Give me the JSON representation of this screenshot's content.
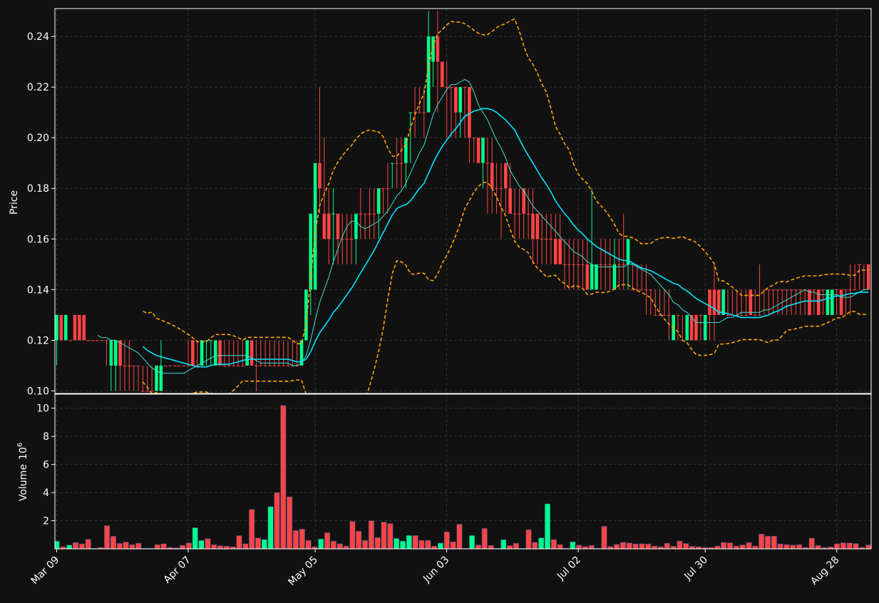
{
  "chart_data": {
    "type": "candlestick",
    "x": [
      "2024-03-09",
      "2024-03-10",
      "2024-03-11",
      "2024-03-12",
      "2024-03-13",
      "2024-03-14",
      "2024-03-15",
      "2024-03-16",
      "2024-03-17",
      "2024-03-18",
      "2024-03-19",
      "2024-03-20",
      "2024-03-21",
      "2024-03-22",
      "2024-03-23",
      "2024-03-24",
      "2024-03-25",
      "2024-03-26",
      "2024-03-27",
      "2024-03-28",
      "2024-03-29",
      "2024-03-30",
      "2024-03-31",
      "2024-04-01",
      "2024-04-02",
      "2024-04-03",
      "2024-04-04",
      "2024-04-05",
      "2024-04-06",
      "2024-04-07",
      "2024-04-08",
      "2024-04-09",
      "2024-04-10",
      "2024-04-11",
      "2024-04-12",
      "2024-04-13",
      "2024-04-14",
      "2024-04-15",
      "2024-04-16",
      "2024-04-17",
      "2024-04-18",
      "2024-04-19",
      "2024-04-20",
      "2024-04-21",
      "2024-04-22",
      "2024-04-23",
      "2024-04-24",
      "2024-04-25",
      "2024-04-26",
      "2024-04-27",
      "2024-04-28",
      "2024-04-29",
      "2024-04-30",
      "2024-05-01",
      "2024-05-02",
      "2024-05-03",
      "2024-05-04",
      "2024-05-05",
      "2024-05-06",
      "2024-05-07",
      "2024-05-08",
      "2024-05-09",
      "2024-05-10",
      "2024-05-11",
      "2024-05-12",
      "2024-05-13",
      "2024-05-14",
      "2024-05-15",
      "2024-05-16",
      "2024-05-17",
      "2024-05-18",
      "2024-05-19",
      "2024-05-20",
      "2024-05-21",
      "2024-05-22",
      "2024-05-23",
      "2024-05-24",
      "2024-05-25",
      "2024-05-26",
      "2024-05-27",
      "2024-05-28",
      "2024-05-29",
      "2024-05-30",
      "2024-05-31",
      "2024-06-01",
      "2024-06-02",
      "2024-06-03",
      "2024-06-04",
      "2024-06-05",
      "2024-06-06",
      "2024-06-07",
      "2024-06-08",
      "2024-06-09",
      "2024-06-10",
      "2024-06-11",
      "2024-06-12",
      "2024-06-13",
      "2024-06-14",
      "2024-06-15",
      "2024-06-16",
      "2024-06-17",
      "2024-06-18",
      "2024-06-19",
      "2024-06-20",
      "2024-06-21",
      "2024-06-22",
      "2024-06-23",
      "2024-06-24",
      "2024-06-25",
      "2024-06-26",
      "2024-06-27",
      "2024-06-28",
      "2024-06-29",
      "2024-06-30",
      "2024-07-01",
      "2024-07-02",
      "2024-07-03",
      "2024-07-04",
      "2024-07-05",
      "2024-07-06",
      "2024-07-07",
      "2024-07-08",
      "2024-07-09",
      "2024-07-10",
      "2024-07-11",
      "2024-07-12",
      "2024-07-13",
      "2024-07-14",
      "2024-07-15",
      "2024-07-16",
      "2024-07-17",
      "2024-07-18",
      "2024-07-19",
      "2024-07-20",
      "2024-07-21",
      "2024-07-22",
      "2024-07-23",
      "2024-07-24",
      "2024-07-25",
      "2024-07-26",
      "2024-07-27",
      "2024-07-28",
      "2024-07-29",
      "2024-07-30",
      "2024-07-31",
      "2024-08-01",
      "2024-08-02",
      "2024-08-03",
      "2024-08-04",
      "2024-08-05",
      "2024-08-06",
      "2024-08-07",
      "2024-08-08",
      "2024-08-09",
      "2024-08-10",
      "2024-08-11",
      "2024-08-12",
      "2024-08-13",
      "2024-08-14",
      "2024-08-15",
      "2024-08-16",
      "2024-08-17",
      "2024-08-18",
      "2024-08-19",
      "2024-08-20",
      "2024-08-21",
      "2024-08-22",
      "2024-08-23",
      "2024-08-24",
      "2024-08-25",
      "2024-08-26",
      "2024-08-27",
      "2024-08-28",
      "2024-08-29",
      "2024-08-30",
      "2024-08-31",
      "2024-09-01",
      "2024-09-02",
      "2024-09-03",
      "2024-09-04"
    ],
    "open": [
      0.12,
      0.13,
      0.12,
      0.12,
      0.13,
      0.13,
      0.13,
      0.12,
      0.12,
      0.12,
      0.12,
      0.12,
      0.11,
      0.11,
      0.12,
      0.11,
      0.11,
      0.11,
      0.11,
      0.1,
      0.1,
      0.1,
      0.1,
      0.1,
      0.11,
      0.11,
      0.11,
      0.11,
      0.11,
      0.11,
      0.12,
      0.11,
      0.11,
      0.12,
      0.12,
      0.11,
      0.12,
      0.11,
      0.11,
      0.11,
      0.11,
      0.11,
      0.11,
      0.12,
      0.11,
      0.11,
      0.11,
      0.11,
      0.11,
      0.11,
      0.11,
      0.11,
      0.11,
      0.11,
      0.11,
      0.12,
      0.14,
      0.14,
      0.19,
      0.17,
      0.17,
      0.17,
      0.17,
      0.16,
      0.16,
      0.16,
      0.16,
      0.17,
      0.17,
      0.17,
      0.17,
      0.17,
      0.18,
      0.18,
      0.19,
      0.19,
      0.19,
      0.19,
      0.21,
      0.21,
      0.21,
      0.21,
      0.21,
      0.23,
      0.24,
      0.23,
      0.22,
      0.22,
      0.22,
      0.21,
      0.22,
      0.22,
      0.2,
      0.2,
      0.19,
      0.19,
      0.19,
      0.18,
      0.18,
      0.19,
      0.18,
      0.17,
      0.17,
      0.18,
      0.17,
      0.17,
      0.17,
      0.16,
      0.16,
      0.16,
      0.16,
      0.16,
      0.15,
      0.15,
      0.15,
      0.15,
      0.15,
      0.15,
      0.14,
      0.14,
      0.15,
      0.15,
      0.15,
      0.14,
      0.15,
      0.15,
      0.15,
      0.14,
      0.14,
      0.14,
      0.14,
      0.14,
      0.13,
      0.13,
      0.13,
      0.13,
      0.12,
      0.13,
      0.12,
      0.12,
      0.13,
      0.13,
      0.13,
      0.12,
      0.14,
      0.14,
      0.14,
      0.13,
      0.13,
      0.13,
      0.13,
      0.13,
      0.13,
      0.14,
      0.13,
      0.13,
      0.14,
      0.14,
      0.14,
      0.14,
      0.14,
      0.14,
      0.14,
      0.14,
      0.14,
      0.14,
      0.14,
      0.14,
      0.14,
      0.14,
      0.13,
      0.13,
      0.14,
      0.14,
      0.14,
      0.14,
      0.14,
      0.15,
      0.14,
      0.15,
      0.15,
      0.15,
      0.15,
      0.15,
      0.15,
      0.15,
      0.15,
      0.15,
      0.15,
      0.15
    ],
    "high": [
      0.13,
      0.13,
      0.13,
      0.12,
      0.13,
      0.13,
      0.13,
      0.12,
      0.12,
      0.12,
      0.12,
      0.12,
      0.12,
      0.12,
      0.12,
      0.12,
      0.12,
      0.11,
      0.11,
      0.11,
      0.11,
      0.11,
      0.11,
      0.12,
      0.11,
      0.11,
      0.11,
      0.11,
      0.11,
      0.12,
      0.12,
      0.12,
      0.12,
      0.12,
      0.12,
      0.12,
      0.12,
      0.12,
      0.12,
      0.12,
      0.12,
      0.12,
      0.12,
      0.12,
      0.12,
      0.12,
      0.12,
      0.12,
      0.12,
      0.12,
      0.12,
      0.12,
      0.12,
      0.12,
      0.12,
      0.14,
      0.15,
      0.18,
      0.22,
      0.2,
      0.18,
      0.18,
      0.17,
      0.17,
      0.17,
      0.17,
      0.17,
      0.18,
      0.17,
      0.18,
      0.18,
      0.18,
      0.18,
      0.19,
      0.19,
      0.2,
      0.2,
      0.2,
      0.21,
      0.22,
      0.22,
      0.22,
      0.25,
      0.24,
      0.25,
      0.23,
      0.23,
      0.22,
      0.22,
      0.22,
      0.22,
      0.22,
      0.2,
      0.2,
      0.2,
      0.2,
      0.2,
      0.19,
      0.19,
      0.19,
      0.19,
      0.18,
      0.18,
      0.18,
      0.18,
      0.18,
      0.17,
      0.17,
      0.17,
      0.17,
      0.17,
      0.17,
      0.16,
      0.16,
      0.16,
      0.16,
      0.16,
      0.16,
      0.18,
      0.15,
      0.16,
      0.16,
      0.16,
      0.16,
      0.16,
      0.17,
      0.16,
      0.15,
      0.15,
      0.15,
      0.15,
      0.14,
      0.14,
      0.14,
      0.14,
      0.14,
      0.13,
      0.13,
      0.13,
      0.13,
      0.13,
      0.13,
      0.13,
      0.13,
      0.13,
      0.15,
      0.14,
      0.14,
      0.14,
      0.14,
      0.14,
      0.14,
      0.14,
      0.14,
      0.14,
      0.15,
      0.14,
      0.14,
      0.14,
      0.14,
      0.14,
      0.14,
      0.14,
      0.14,
      0.14,
      0.14,
      0.14,
      0.14,
      0.14,
      0.14,
      0.14,
      0.14,
      0.14,
      0.14,
      0.14,
      0.15,
      0.15,
      0.15,
      0.15,
      0.15,
      0.15,
      0.15,
      0.15,
      0.15,
      0.15,
      0.15,
      0.15,
      0.15,
      0.15,
      0.15,
      0.15,
      0.15
    ],
    "low": [
      0.11,
      0.12,
      0.12,
      0.12,
      0.12,
      0.12,
      0.12,
      0.12,
      0.12,
      0.12,
      0.12,
      0.11,
      0.1,
      0.1,
      0.1,
      0.1,
      0.1,
      0.1,
      0.1,
      0.1,
      0.1,
      0.1,
      0.1,
      0.1,
      0.11,
      0.11,
      0.11,
      0.11,
      0.11,
      0.11,
      0.11,
      0.11,
      0.11,
      0.11,
      0.11,
      0.11,
      0.11,
      0.11,
      0.11,
      0.11,
      0.11,
      0.11,
      0.11,
      0.11,
      0.1,
      0.11,
      0.11,
      0.11,
      0.11,
      0.11,
      0.11,
      0.11,
      0.11,
      0.11,
      0.11,
      0.12,
      0.13,
      0.14,
      0.17,
      0.17,
      0.15,
      0.15,
      0.15,
      0.15,
      0.15,
      0.15,
      0.15,
      0.16,
      0.16,
      0.16,
      0.16,
      0.16,
      0.17,
      0.17,
      0.18,
      0.18,
      0.18,
      0.18,
      0.19,
      0.2,
      0.21,
      0.2,
      0.21,
      0.22,
      0.21,
      0.22,
      0.2,
      0.2,
      0.2,
      0.2,
      0.2,
      0.19,
      0.19,
      0.19,
      0.18,
      0.17,
      0.17,
      0.17,
      0.16,
      0.17,
      0.17,
      0.16,
      0.16,
      0.16,
      0.16,
      0.15,
      0.15,
      0.15,
      0.15,
      0.15,
      0.15,
      0.15,
      0.14,
      0.14,
      0.14,
      0.14,
      0.14,
      0.14,
      0.14,
      0.14,
      0.14,
      0.14,
      0.14,
      0.14,
      0.14,
      0.14,
      0.14,
      0.14,
      0.14,
      0.14,
      0.13,
      0.13,
      0.13,
      0.13,
      0.13,
      0.12,
      0.12,
      0.12,
      0.12,
      0.12,
      0.12,
      0.12,
      0.12,
      0.12,
      0.12,
      0.12,
      0.13,
      0.13,
      0.13,
      0.13,
      0.13,
      0.13,
      0.13,
      0.13,
      0.13,
      0.13,
      0.13,
      0.13,
      0.13,
      0.13,
      0.13,
      0.13,
      0.13,
      0.13,
      0.13,
      0.13,
      0.13,
      0.13,
      0.13,
      0.13,
      0.13,
      0.13,
      0.13,
      0.13,
      0.13,
      0.13,
      0.14,
      0.14,
      0.14,
      0.14,
      0.14,
      0.14,
      0.14,
      0.14,
      0.14,
      0.14,
      0.14,
      0.14,
      0.14,
      0.14,
      0.14,
      0.14,
      0.14
    ],
    "close": [
      0.13,
      0.12,
      0.13,
      0.12,
      0.12,
      0.12,
      0.12,
      0.12,
      0.12,
      0.12,
      0.12,
      0.12,
      0.12,
      0.12,
      0.11,
      0.11,
      0.11,
      0.11,
      0.11,
      0.1,
      0.1,
      0.1,
      0.11,
      0.11,
      0.11,
      0.11,
      0.11,
      0.11,
      0.11,
      0.11,
      0.11,
      0.11,
      0.12,
      0.12,
      0.12,
      0.12,
      0.11,
      0.11,
      0.11,
      0.11,
      0.11,
      0.11,
      0.12,
      0.11,
      0.11,
      0.11,
      0.11,
      0.11,
      0.11,
      0.11,
      0.11,
      0.11,
      0.11,
      0.11,
      0.12,
      0.14,
      0.17,
      0.19,
      0.18,
      0.16,
      0.16,
      0.17,
      0.16,
      0.16,
      0.16,
      0.16,
      0.17,
      0.17,
      0.17,
      0.17,
      0.17,
      0.18,
      0.18,
      0.18,
      0.19,
      0.19,
      0.19,
      0.2,
      0.21,
      0.21,
      0.21,
      0.21,
      0.24,
      0.24,
      0.23,
      0.22,
      0.22,
      0.22,
      0.21,
      0.22,
      0.22,
      0.2,
      0.2,
      0.19,
      0.2,
      0.19,
      0.18,
      0.18,
      0.18,
      0.18,
      0.17,
      0.17,
      0.17,
      0.17,
      0.17,
      0.16,
      0.16,
      0.16,
      0.16,
      0.16,
      0.15,
      0.15,
      0.15,
      0.15,
      0.15,
      0.15,
      0.15,
      0.14,
      0.15,
      0.15,
      0.15,
      0.15,
      0.15,
      0.15,
      0.15,
      0.15,
      0.16,
      0.14,
      0.14,
      0.14,
      0.14,
      0.14,
      0.13,
      0.13,
      0.13,
      0.13,
      0.13,
      0.13,
      0.12,
      0.13,
      0.12,
      0.12,
      0.13,
      0.13,
      0.13,
      0.13,
      0.13,
      0.14,
      0.13,
      0.13,
      0.13,
      0.13,
      0.13,
      0.13,
      0.13,
      0.13,
      0.14,
      0.14,
      0.14,
      0.14,
      0.14,
      0.14,
      0.14,
      0.14,
      0.14,
      0.14,
      0.13,
      0.14,
      0.13,
      0.14,
      0.14,
      0.14,
      0.14,
      0.13,
      0.14,
      0.14,
      0.14,
      0.15,
      0.14,
      0.14,
      0.14,
      0.15,
      0.14,
      0.14,
      0.14,
      0.14,
      0.14,
      0.14,
      0.14,
      0.14,
      0.14,
      0.14,
      0.14,
      0.14,
      0.14
    ],
    "volume": [
      0.55,
      0.15,
      0.27,
      0.45,
      0.36,
      0.68,
      0.04,
      0.1,
      1.65,
      0.89,
      0.39,
      0.48,
      0.3,
      0.4,
      0.04,
      0.04,
      0.3,
      0.36,
      0.1,
      0.07,
      0.25,
      0.42,
      1.5,
      0.6,
      0.72,
      0.29,
      0.22,
      0.19,
      0.15,
      0.94,
      0.36,
      2.8,
      0.77,
      0.66,
      3.0,
      4.0,
      10.2,
      3.7,
      1.3,
      1.4,
      0.6,
      0.15,
      0.7,
      1.15,
      0.55,
      0.36,
      0.2,
      1.95,
      1.25,
      0.6,
      2.0,
      0.8,
      1.9,
      1.8,
      0.74,
      0.55,
      0.95,
      0.95,
      0.6,
      0.6,
      0.2,
      0.41,
      1.2,
      0.5,
      1.75,
      0.04,
      0.95,
      0.28,
      1.45,
      0.24,
      0.04,
      0.65,
      0.23,
      0.4,
      0.04,
      1.35,
      0.47,
      0.78,
      3.2,
      0.66,
      0.3,
      0.04,
      0.5,
      0.26,
      0.16,
      0.24,
      0.04,
      1.6,
      0.16,
      0.32,
      0.46,
      0.42,
      0.35,
      0.36,
      0.35,
      0.2,
      0.15,
      0.4,
      0.18,
      0.55,
      0.38,
      0.18,
      0.15,
      0.1,
      0.1,
      0.2,
      0.45,
      0.43,
      0.2,
      0.28,
      0.45,
      0.2,
      1.05,
      0.9,
      0.9,
      0.35,
      0.3,
      0.27,
      0.3,
      0.1,
      0.76,
      0.24,
      0.1,
      0.14,
      0.36,
      0.43,
      0.42,
      0.38,
      0.1,
      0.28
    ],
    "up": [
      true,
      false,
      true,
      false,
      false,
      false,
      false,
      false,
      false,
      false,
      false,
      false,
      false,
      false,
      false,
      false,
      false,
      false,
      false,
      false,
      false,
      false,
      true,
      true,
      false,
      false,
      false,
      false,
      false,
      false,
      false,
      false,
      false,
      true,
      true,
      false,
      false,
      false,
      false,
      false,
      false,
      false,
      true,
      false,
      false,
      false,
      false,
      false,
      false,
      false,
      false,
      false,
      false,
      false,
      true,
      true,
      true,
      false,
      false,
      false,
      false,
      true,
      false,
      false,
      false,
      false,
      true,
      false,
      false,
      false,
      false,
      true,
      false,
      false,
      true,
      false,
      false,
      true,
      true,
      false,
      false,
      false,
      true,
      false,
      false,
      false,
      false,
      false,
      false,
      false,
      false,
      false,
      false,
      false,
      false,
      false,
      false,
      false,
      false,
      false,
      false,
      false,
      false,
      false,
      false,
      false,
      false,
      false,
      false,
      false,
      false,
      false,
      false,
      false,
      false,
      false,
      false,
      false,
      false,
      false,
      false,
      false,
      false,
      false,
      false,
      false,
      false,
      false,
      false,
      false
    ],
    "lines": {
      "sma_fast": {
        "color": "#40e0d0"
      },
      "sma_slow": {
        "color": "#00e5ff"
      },
      "bb_upper": {
        "color": "#ffa500"
      },
      "bb_lower": {
        "color": "#ffa500"
      }
    },
    "xtick_labels": [
      "Mar 09",
      "Apr 07",
      "May 05",
      "Jun 03",
      "Jul 02",
      "Jul 30",
      "Aug 28"
    ],
    "ylabel": "Price",
    "ylim": [
      0.099,
      0.251
    ],
    "yticks": [
      "0.10",
      "0.12",
      "0.14",
      "0.16",
      "0.18",
      "0.20",
      "0.22",
      "0.24"
    ],
    "volume_ylabel": "Volume",
    "volume_exponent_base": "10",
    "volume_exponent": "6",
    "volume_ylim": [
      0,
      11
    ],
    "volume_yticks": [
      "2",
      "4",
      "6",
      "8",
      "10"
    ],
    "colors": {
      "up": "#00ff88",
      "down": "#ff4444",
      "background": "#111111",
      "grid": "#333333",
      "text": "#ffffff"
    }
  }
}
